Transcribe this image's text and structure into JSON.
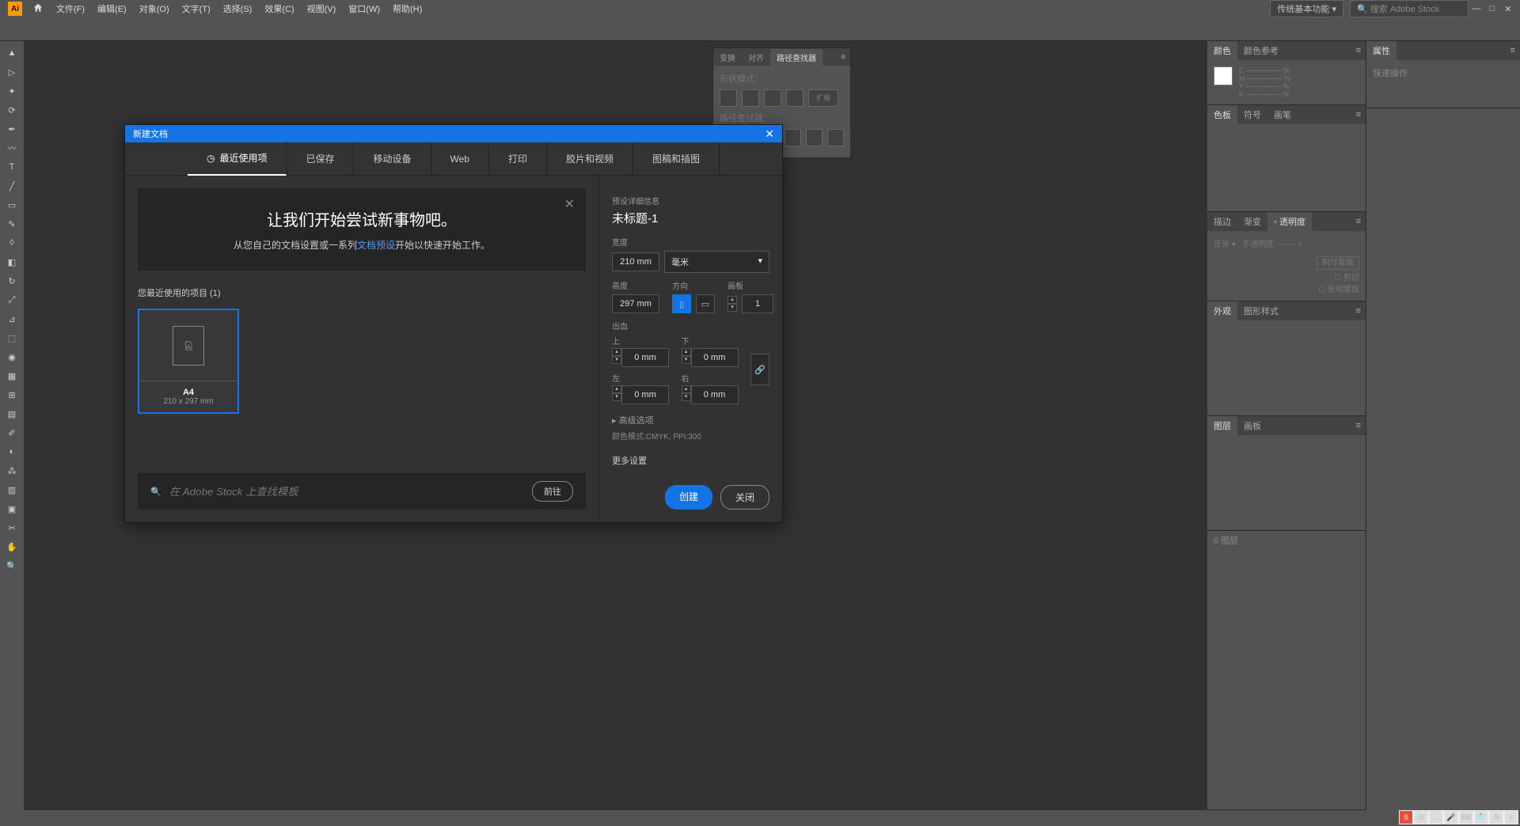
{
  "menubar": {
    "items": [
      "文件(F)",
      "编辑(E)",
      "对象(O)",
      "文字(T)",
      "选择(S)",
      "效果(C)",
      "视图(V)",
      "窗口(W)",
      "帮助(H)"
    ],
    "workspace": "传统基本功能",
    "search_placeholder": "搜索 Adobe Stock"
  },
  "pathfinder": {
    "tabs": [
      "变换",
      "对齐",
      "路径查找器"
    ],
    "shape_label": "形状模式：",
    "expand": "扩展",
    "pf_label": "路径查找器："
  },
  "dialog": {
    "title": "新建文档",
    "tabs": [
      "最近使用项",
      "已保存",
      "移动设备",
      "Web",
      "打印",
      "胶片和视频",
      "图稿和插图"
    ],
    "banner_title": "让我们开始尝试新事物吧。",
    "banner_text_pre": "从您自己的文档设置或一系列",
    "banner_link": "文档预设",
    "banner_text_post": "开始以快速开始工作。",
    "recent_label": "您最近使用的项目 (1)",
    "preset": {
      "name": "A4",
      "dim": "210 x 297 mm"
    },
    "stock_placeholder": "在 Adobe Stock 上查找模板",
    "stock_go": "前往",
    "details_title": "预设详细信息",
    "doc_name": "未标题-1",
    "width_label": "宽度",
    "width_value": "210 mm",
    "unit": "毫米",
    "height_label": "高度",
    "height_value": "297 mm",
    "orient_label": "方向",
    "artboard_label": "画板",
    "artboard_value": "1",
    "bleed_label": "出血",
    "bleed": {
      "top": "上",
      "bottom": "下",
      "left": "左",
      "right": "右",
      "value": "0 mm"
    },
    "advanced": "高级选项",
    "color_mode": "颜色模式:CMYK, PPI:300",
    "more_settings": "更多设置",
    "create": "创建",
    "close": "关闭"
  },
  "panels": {
    "color": {
      "tabs": [
        "颜色",
        "颜色参考"
      ],
      "chans": [
        "C",
        "M",
        "Y",
        "K"
      ]
    },
    "swatch": {
      "tabs": [
        "色板",
        "符号",
        "画笔"
      ]
    },
    "stroke": {
      "tabs": [
        "描边",
        "渐变",
        "透明度"
      ],
      "opacity_label": "不透明度",
      "make_mask": "制作蒙版",
      "clip": "剪切",
      "invert": "反相蒙版"
    },
    "appearance": {
      "tabs": [
        "外观",
        "图形样式"
      ]
    },
    "layers": {
      "tabs": [
        "图层",
        "画板"
      ],
      "status": "0 图层"
    },
    "properties": {
      "tab": "属性",
      "quick": "快速操作"
    }
  }
}
